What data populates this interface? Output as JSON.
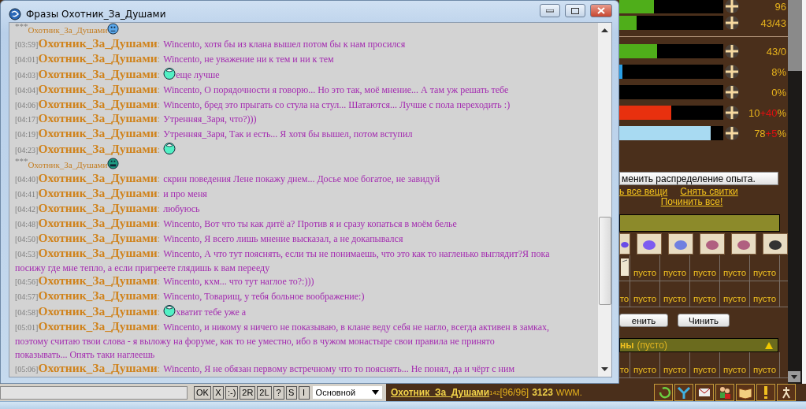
{
  "window": {
    "title": "Фразы Охотник_За_Душами"
  },
  "chat": {
    "separator": ":",
    "messages": [
      {
        "kind": "status",
        "marker": "***",
        "author": "Охотник_За_Душами",
        "smiley": {
          "kind": "neutral"
        }
      },
      {
        "kind": "message",
        "time": "[03:59]",
        "author": "Охотник_За_Душами",
        "text": "Wincento, хотя бы из клана вышел потом бы к нам просился"
      },
      {
        "kind": "message",
        "time": "[04:01]",
        "author": "Охотник_За_Душами",
        "text": "Wincento, не уважение ни к тем и ни к тем"
      },
      {
        "kind": "message",
        "time": "[04:03]",
        "author": "Охотник_За_Душами",
        "smiley": {
          "kind": "ball"
        },
        "text": "еще лучше"
      },
      {
        "kind": "message",
        "time": "[04:04]",
        "author": "Охотник_За_Душами",
        "text": "Wincento, О порядочности я говорю... Но это так, моё мнение... А там уж решать тебе"
      },
      {
        "kind": "message",
        "time": "[04:06]",
        "author": "Охотник_За_Душами",
        "text": "Wincento, бред это прыгать со стула на стул... Шатаются... Лучше с пола переходить :)"
      },
      {
        "kind": "message",
        "time": "[04:17]",
        "author": "Охотник_За_Душами",
        "text": "Утренняя_Заря, что?)))"
      },
      {
        "kind": "message",
        "time": "[04:19]",
        "author": "Охотник_За_Душами",
        "text": "Утренняя_Заря, Так и есть... Я хотя бы вышел, потом вступил"
      },
      {
        "kind": "message",
        "time": "[04:23]",
        "author": "Охотник_За_Душами",
        "smiley": {
          "kind": "ball"
        }
      },
      {
        "kind": "status",
        "marker": "***",
        "author": "Охотник_За_Душами",
        "smiley": {
          "kind": "grin"
        }
      },
      {
        "kind": "message",
        "time": "[04:40]",
        "author": "Охотник_За_Душами",
        "text": "скрин поведения Лене покажу днем... Досье мое богатое, не завидуй"
      },
      {
        "kind": "message",
        "time": "[04:41]",
        "author": "Охотник_За_Душами",
        "text": "и про меня"
      },
      {
        "kind": "message",
        "time": "[04:42]",
        "author": "Охотник_За_Душами",
        "text": "любуюсь"
      },
      {
        "kind": "message",
        "time": "[04:48]",
        "author": "Охотник_За_Душами",
        "text": "Wincento, Вот что ты как дитё а? Против я и сразу копаться в моём белье"
      },
      {
        "kind": "message",
        "time": "[04:50]",
        "author": "Охотник_За_Душами",
        "text": "Wincento, Я всего лишь мнение высказал, а не докапывался"
      },
      {
        "kind": "message",
        "time": "[04:53]",
        "author": "Охотник_За_Душами",
        "text": "Wincento, А что тут пояснять, если ты не понимаешь, что это как то нагленько выглядит?Я пока",
        "continued": [
          "посижу где мне тепло, а если пригреете глядишь к вам перееду"
        ]
      },
      {
        "kind": "message",
        "time": "[04:56]",
        "author": "Охотник_За_Душами",
        "text": "Wincento, кхм... что тут наглое то?:)))"
      },
      {
        "kind": "message",
        "time": "[04:57]",
        "author": "Охотник_За_Душами",
        "text": "Wincento, Товарищ, у тебя больное воображение:)"
      },
      {
        "kind": "message",
        "time": "[04:58]",
        "author": "Охотник_За_Душами",
        "smiley": {
          "kind": "ball"
        },
        "text": "хватит тебе уже а"
      },
      {
        "kind": "message",
        "time": "[05:01]",
        "author": "Охотник_За_Душами",
        "text": "Wincento, и никому я ничего не показываю, в клане веду себя не нагло, всегда активен в замках,",
        "continued": [
          "поэтому считаю твои слова - я выложу на форуме, как то не уместно, ибо в чужом монастыре свои правила не принято",
          "показывать... Опять таки наглеешь"
        ]
      },
      {
        "kind": "message",
        "time": "[05:06]",
        "author": "Охотник_За_Душами",
        "text": "Wincento, Я не обязан первому встречному что то пояснять... Не понял, да и чёрт с ним"
      }
    ]
  },
  "input": {
    "buttons": [
      "OK",
      "X",
      ":-)",
      "2R",
      "2L",
      "?",
      "S",
      "I"
    ],
    "channel": "Основной"
  },
  "player": {
    "name": "Охотник_За_Душами",
    "level": "142",
    "hp": "[96/96]",
    "money": "3123",
    "currency": "WWM."
  },
  "stats": [
    {
      "value": "96",
      "level": 0.33,
      "color": "#4fae1a"
    },
    {
      "value": "43/43",
      "level": 0.17,
      "color": "#4fae1a"
    },
    {
      "value": "43/0",
      "level": 0.36,
      "color": "#4fae1a"
    },
    {
      "value": "8%",
      "level": 0.03,
      "color": "#2a9fe6"
    },
    {
      "value": "0%",
      "level": 0
    },
    {
      "value": "10",
      "bonus": "+40",
      "unit": "%",
      "level": 0.5,
      "color": "#e8300e"
    },
    {
      "value": "78",
      "bonus": "+5",
      "unit": "%",
      "level": 0.88,
      "color": "#a8daf2"
    }
  ],
  "experience_button": "менить распределение опыта.",
  "links": [
    {
      "text": "ь все вещи"
    },
    {
      "text": "Снять свитки"
    }
  ],
  "repair_all_link": "Починить все!",
  "slot_rows": [
    {
      "partial_icon": true,
      "cells": [
        "пусто",
        "пусто",
        "пусто",
        "пусто",
        "пусто"
      ]
    },
    {
      "partial_text": "то",
      "cells": [
        "пусто",
        "пусто",
        "пусто",
        "пусто",
        "пусто"
      ]
    }
  ],
  "buttons": [
    "енить",
    "Чинить"
  ],
  "section": {
    "title": "ны",
    "count": "(пусто)",
    "rows": [
      {
        "partial_text": "то",
        "cells": [
          "пусто",
          "пусто",
          "пусто",
          "пусто",
          "пусто"
        ]
      }
    ]
  }
}
